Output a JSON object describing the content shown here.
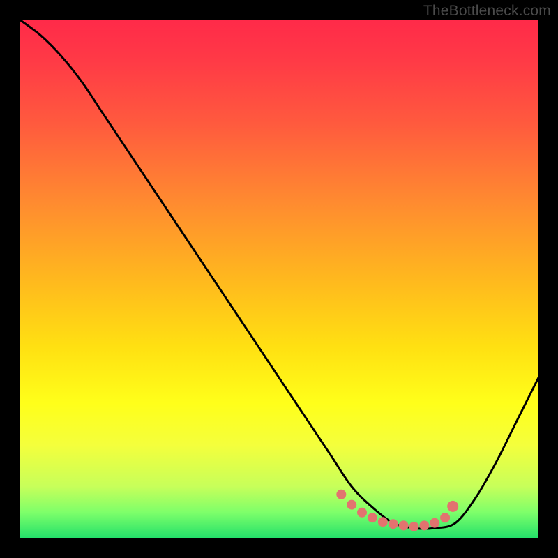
{
  "watermark": "TheBottleneck.com",
  "chart_data": {
    "type": "line",
    "title": "",
    "xlabel": "",
    "ylabel": "",
    "xlim": [
      0,
      100
    ],
    "ylim": [
      0,
      100
    ],
    "background_gradient": {
      "stops": [
        {
          "offset": 0.0,
          "color": "#ff2a49"
        },
        {
          "offset": 0.08,
          "color": "#ff3a46"
        },
        {
          "offset": 0.2,
          "color": "#ff5a3e"
        },
        {
          "offset": 0.35,
          "color": "#ff8a30"
        },
        {
          "offset": 0.5,
          "color": "#ffb81e"
        },
        {
          "offset": 0.63,
          "color": "#ffe012"
        },
        {
          "offset": 0.74,
          "color": "#ffff1a"
        },
        {
          "offset": 0.82,
          "color": "#f4ff3c"
        },
        {
          "offset": 0.9,
          "color": "#c7ff5a"
        },
        {
          "offset": 0.95,
          "color": "#7dff6a"
        },
        {
          "offset": 1.0,
          "color": "#22e06a"
        }
      ]
    },
    "series": [
      {
        "name": "bottleneck-curve",
        "color": "#000000",
        "x": [
          0,
          4,
          8,
          12,
          16,
          20,
          26,
          32,
          38,
          44,
          50,
          56,
          60,
          64,
          68,
          72,
          76,
          80,
          84,
          88,
          92,
          96,
          100
        ],
        "y": [
          100,
          97,
          93,
          88,
          82,
          76,
          67,
          58,
          49,
          40,
          31,
          22,
          16,
          10,
          6,
          3,
          2,
          2,
          3,
          8,
          15,
          23,
          31
        ]
      }
    ],
    "markers": {
      "name": "optimal-range",
      "color": "#e2736f",
      "points": [
        {
          "x": 62,
          "y": 8.5
        },
        {
          "x": 64,
          "y": 6.5
        },
        {
          "x": 66,
          "y": 5.0
        },
        {
          "x": 68,
          "y": 4.0
        },
        {
          "x": 70,
          "y": 3.2
        },
        {
          "x": 72,
          "y": 2.8
        },
        {
          "x": 74,
          "y": 2.5
        },
        {
          "x": 76,
          "y": 2.3
        },
        {
          "x": 78,
          "y": 2.5
        },
        {
          "x": 80,
          "y": 3.0
        },
        {
          "x": 82,
          "y": 4.0
        },
        {
          "x": 83.5,
          "y": 6.2
        }
      ]
    }
  }
}
